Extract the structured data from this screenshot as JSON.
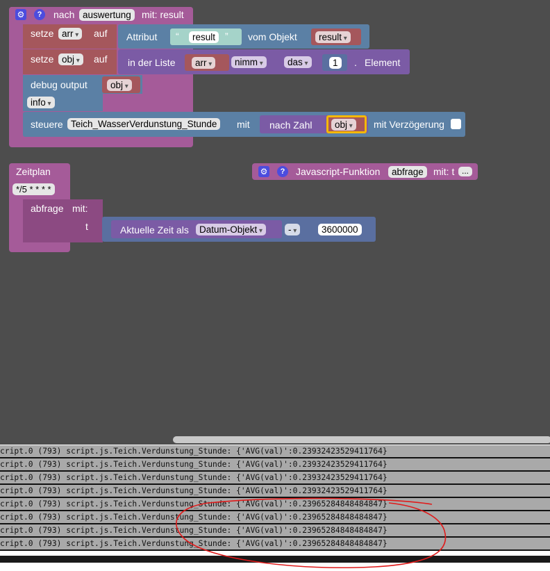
{
  "block_on": {
    "prefix": "nach",
    "trigger": "auswertung",
    "suffix": "mit: result",
    "set_arr": {
      "label": "setze",
      "var": "arr",
      "suffix": "auf"
    },
    "attr": {
      "label": "Attribut",
      "key": "result",
      "of_object": "vom Objekt",
      "object": "result"
    },
    "set_obj": {
      "label": "setze",
      "var": "obj",
      "suffix": "auf"
    },
    "list": {
      "label": "in der Liste",
      "list": "arr",
      "take": "nimm",
      "which": "das",
      "index": "1",
      "dot": ".",
      "element": "Element"
    },
    "debug": {
      "label": "debug output",
      "value": "obj",
      "level": "info"
    },
    "control": {
      "label": "steuere",
      "target": "Teich_WasserVerdunstung_Stunde",
      "with": "mit",
      "to_number": "nach Zahl",
      "value": "obj",
      "delay": "mit Verzögerung"
    }
  },
  "block_schedule": {
    "label": "Zeitplan",
    "cron": "*/5 * * * *",
    "call": {
      "label": "abfrage",
      "with": "mit:",
      "param": "t",
      "now": "Aktuelle Zeit als",
      "format": "Datum-Objekt",
      "op": "-",
      "value": "3600000"
    }
  },
  "block_function": {
    "label": "Javascript-Funktion",
    "name": "abfrage",
    "params": "mit: t",
    "more": "..."
  },
  "log": [
    "cript.0 (793) script.js.Teich.Verdunstung_Stunde: {'AVG(val)':0.23932423529411764}",
    "cript.0 (793) script.js.Teich.Verdunstung_Stunde: {'AVG(val)':0.23932423529411764}",
    "cript.0 (793) script.js.Teich.Verdunstung_Stunde: {'AVG(val)':0.23932423529411764}",
    "cript.0 (793) script.js.Teich.Verdunstung_Stunde: {'AVG(val)':0.23932423529411764}",
    "cript.0 (793) script.js.Teich.Verdunstung_Stunde: {'AVG(val)':0.23965284848484847}",
    "cript.0 (793) script.js.Teich.Verdunstung_Stunde: {'AVG(val)':0.23965284848484847}",
    "cript.0 (793) script.js.Teich.Verdunstung_Stunde: {'AVG(val)':0.23965284848484847}",
    "cript.0 (793) script.js.Teich.Verdunstung_Stunde: {'AVG(val)':0.23965284848484847}"
  ],
  "colors": {
    "workspace": "#4d4d4d",
    "event_block": "#a55b99",
    "variable": "#a5575c",
    "io_block": "#5b80a5",
    "highlight": "#f5b800",
    "annotation": "#e01b1b"
  }
}
